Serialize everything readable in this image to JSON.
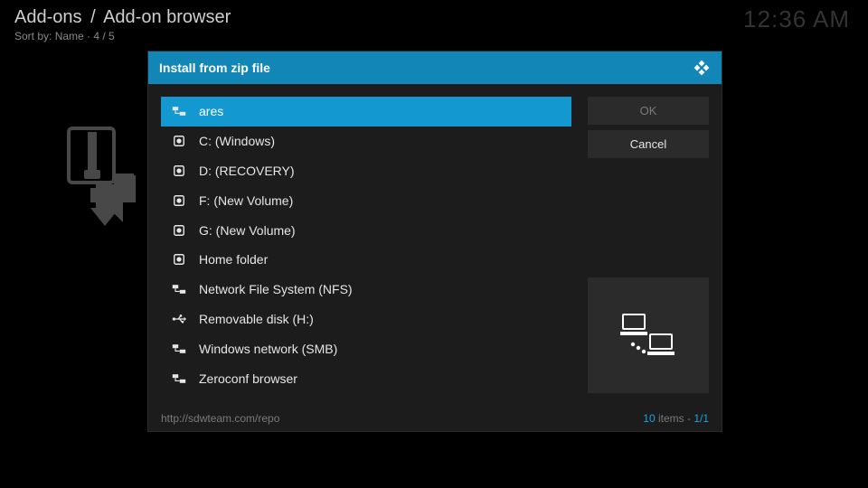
{
  "header": {
    "breadcrumb": {
      "part1": "Add-ons",
      "sep": "/",
      "part2": "Add-on browser"
    },
    "sort_prefix": "Sort by: ",
    "sort_value": "Name",
    "sort_sep": "  ·  ",
    "sort_page": "4 / 5",
    "clock": "12:36 AM"
  },
  "dialog": {
    "title": "Install from zip file",
    "items": [
      {
        "label": "ares",
        "icon": "network-share-icon",
        "selected": true
      },
      {
        "label": "C: (Windows)",
        "icon": "hard-drive-icon",
        "selected": false
      },
      {
        "label": "D: (RECOVERY)",
        "icon": "hard-drive-icon",
        "selected": false
      },
      {
        "label": "F: (New Volume)",
        "icon": "hard-drive-icon",
        "selected": false
      },
      {
        "label": "G: (New Volume)",
        "icon": "hard-drive-icon",
        "selected": false
      },
      {
        "label": "Home folder",
        "icon": "hard-drive-icon",
        "selected": false
      },
      {
        "label": "Network File System (NFS)",
        "icon": "network-share-icon",
        "selected": false
      },
      {
        "label": "Removable disk (H:)",
        "icon": "usb-icon",
        "selected": false
      },
      {
        "label": "Windows network (SMB)",
        "icon": "network-share-icon",
        "selected": false
      },
      {
        "label": "Zeroconf browser",
        "icon": "network-share-icon",
        "selected": false
      }
    ],
    "buttons": {
      "ok": "OK",
      "cancel": "Cancel"
    },
    "footer": {
      "path": "http://sdwteam.com/repo",
      "count": "10",
      "count_suffix": " items - ",
      "page": "1/1"
    }
  }
}
